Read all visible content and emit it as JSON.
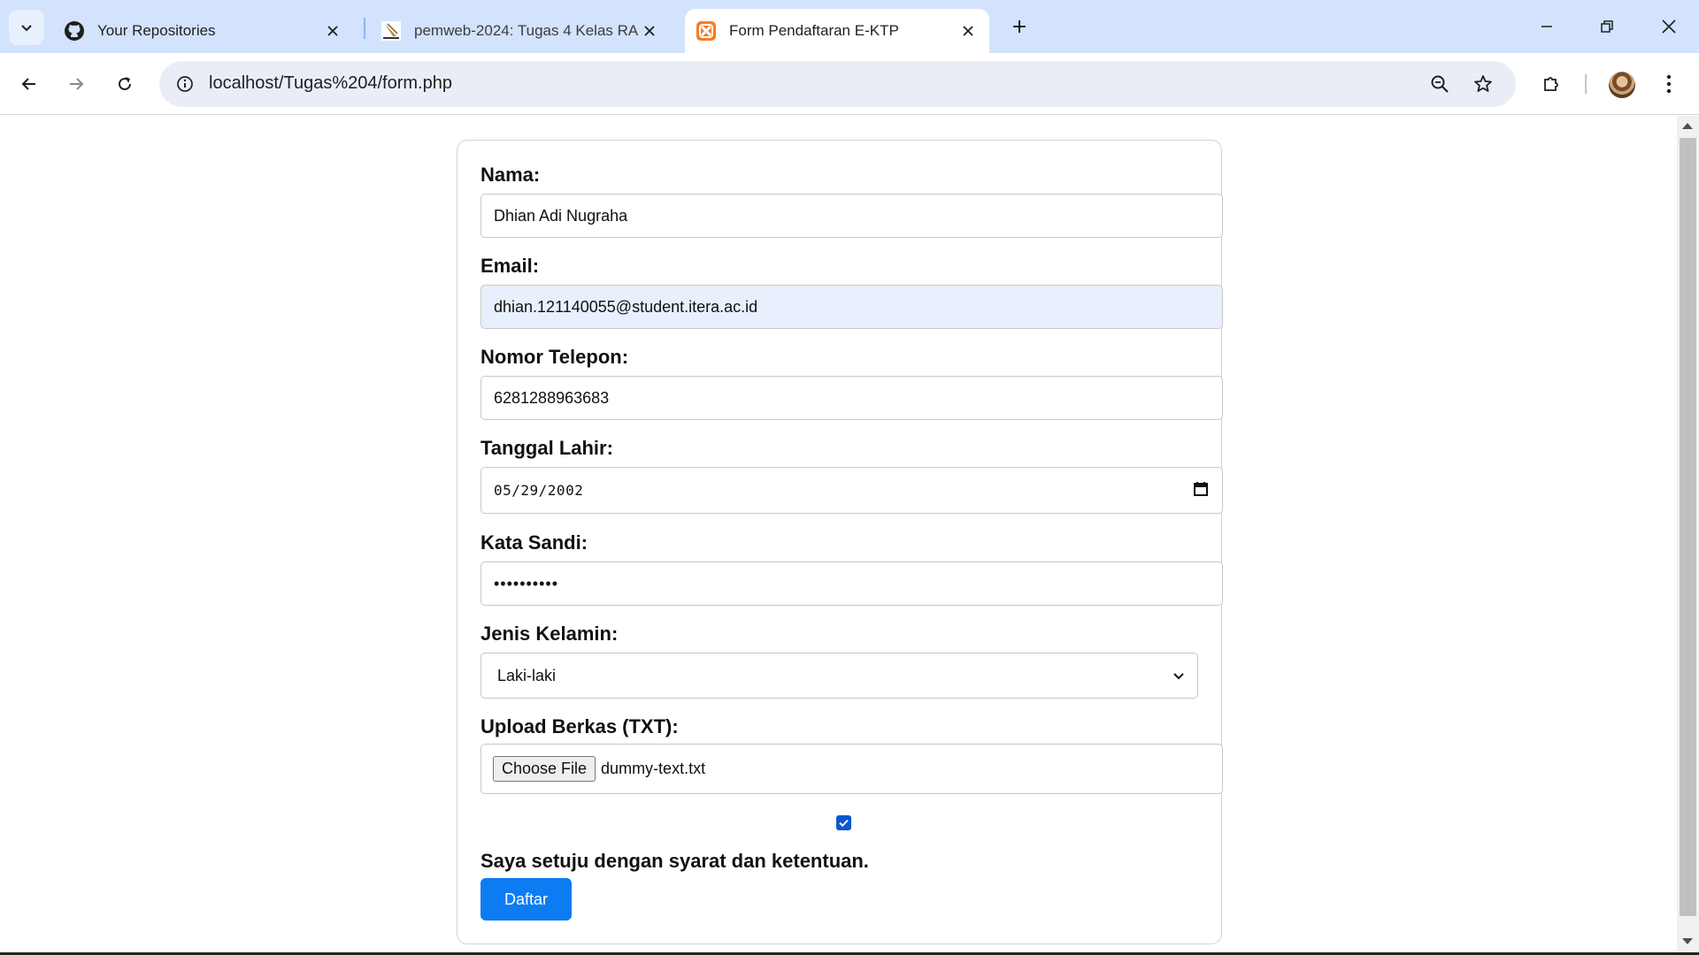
{
  "browser": {
    "tabs": [
      {
        "title": "Your Repositories",
        "favicon": "github-icon",
        "active": false
      },
      {
        "title": "pemweb-2024: Tugas 4 Kelas RA",
        "favicon": "itera-logo-icon",
        "active": false
      },
      {
        "title": "Form Pendaftaran E-KTP",
        "favicon": "xampp-icon",
        "active": true
      }
    ],
    "url": "localhost/Tugas%204/form.php",
    "colors": {
      "tabbar": "#d3e3fd",
      "omnibox": "#e9eef6",
      "accent": "#0b57d0"
    }
  },
  "form": {
    "nama": {
      "label": "Nama:",
      "value": "Dhian Adi Nugraha"
    },
    "email": {
      "label": "Email:",
      "value": "dhian.121140055@student.itera.ac.id"
    },
    "telepon": {
      "label": "Nomor Telepon:",
      "value": "6281288963683"
    },
    "tanggal": {
      "label": "Tanggal Lahir:",
      "value": "05/29/2002"
    },
    "sandi": {
      "label": "Kata Sandi:",
      "value": "••••••••••"
    },
    "kelamin": {
      "label": "Jenis Kelamin:",
      "value": "Laki-laki"
    },
    "berkas": {
      "label": "Upload Berkas (TXT):",
      "button": "Choose File",
      "filename": "dummy-text.txt"
    },
    "agree": {
      "label": "Saya setuju dengan syarat dan ketentuan.",
      "checked": true
    },
    "submit": {
      "label": "Daftar",
      "color": "#0d7cf2"
    }
  }
}
